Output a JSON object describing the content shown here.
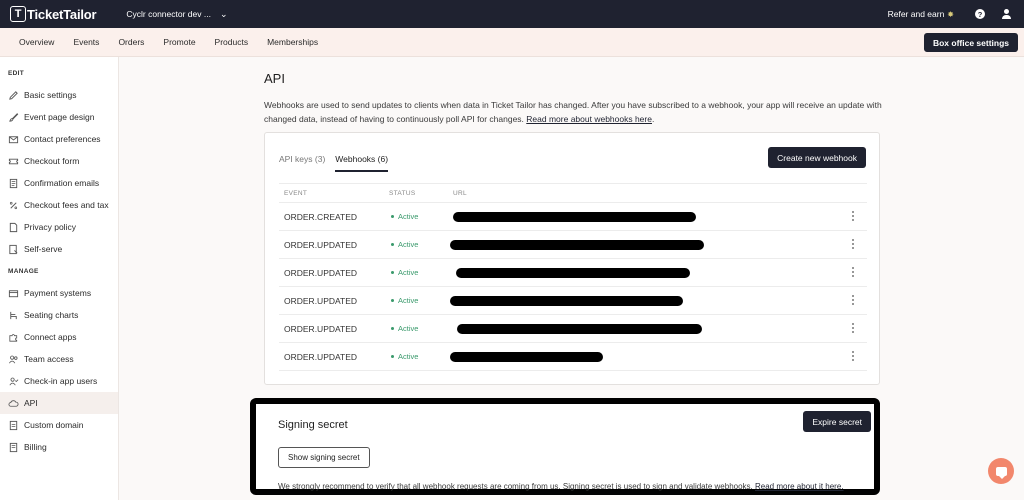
{
  "topbar": {
    "logo": "TicketTailor",
    "account": "Cyclr connector dev ...",
    "refer": "Refer and earn",
    "help": "?"
  },
  "nav": {
    "items": [
      "Overview",
      "Events",
      "Orders",
      "Promote",
      "Products",
      "Memberships"
    ],
    "box_office": "Box office settings"
  },
  "sidebar": {
    "edit_label": "EDIT",
    "manage_label": "MANAGE",
    "edit_items": [
      "Basic settings",
      "Event page design",
      "Contact preferences",
      "Checkout form",
      "Confirmation emails",
      "Checkout fees and tax",
      "Privacy policy",
      "Self-serve"
    ],
    "manage_items": [
      "Payment systems",
      "Seating charts",
      "Connect apps",
      "Team access",
      "Check-in app users",
      "API",
      "Custom domain",
      "Billing"
    ]
  },
  "main": {
    "title": "API",
    "description": "Webhooks are used to send updates to clients when data in Ticket Tailor has changed. After you have subscribed to a webhook, your app will receive an update with changed data, instead of having to continuously poll API for changes.",
    "description_link": "Read more about webhooks here",
    "tabs": [
      "API keys (3)",
      "Webhooks (6)"
    ],
    "create_button": "Create new webhook",
    "columns": [
      "EVENT",
      "STATUS",
      "URL"
    ],
    "rows": [
      {
        "event": "ORDER.CREATED",
        "status": "Active"
      },
      {
        "event": "ORDER.UPDATED",
        "status": "Active"
      },
      {
        "event": "ORDER.UPDATED",
        "status": "Active"
      },
      {
        "event": "ORDER.UPDATED",
        "status": "Active"
      },
      {
        "event": "ORDER.UPDATED",
        "status": "Active"
      },
      {
        "event": "ORDER.UPDATED",
        "status": "Active"
      }
    ]
  },
  "signing": {
    "title": "Signing secret",
    "expire_button": "Expire secret",
    "show_button": "Show signing secret",
    "description": "We strongly recommend to verify that all webhook requests are coming from us. Signing secret is used to sign and validate webhooks.",
    "link": "Read more about it here."
  },
  "colors": {
    "dark": "#1f2230",
    "active_status": "#3a9a6c",
    "nav_bg": "#fbf0ec",
    "chat": "#f2876c"
  }
}
